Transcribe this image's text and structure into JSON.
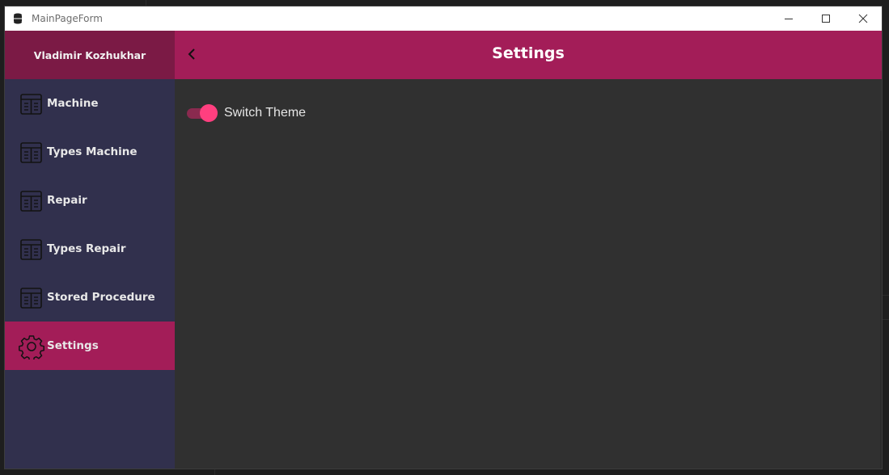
{
  "window": {
    "title": "MainPageForm"
  },
  "sidebar": {
    "user_name": "Vladimir Kozhukhar",
    "items": [
      {
        "label": "Machine",
        "icon": "table-icon",
        "active": false
      },
      {
        "label": "Types Machine",
        "icon": "table-icon",
        "active": false
      },
      {
        "label": "Repair",
        "icon": "table-icon",
        "active": false
      },
      {
        "label": "Types Repair",
        "icon": "table-icon",
        "active": false
      },
      {
        "label": "Stored Procedure",
        "icon": "table-icon",
        "active": false
      },
      {
        "label": "Settings",
        "icon": "gear-icon",
        "active": true
      }
    ]
  },
  "header": {
    "title": "Settings",
    "back_icon": "chevron-left-icon"
  },
  "settings": {
    "theme_toggle_label": "Switch Theme",
    "theme_toggle_on": true
  },
  "colors": {
    "accent": "#a31d58",
    "user_panel": "#7b1a45",
    "sidebar_bg": "#31304d",
    "content_bg": "#303030",
    "toggle_thumb": "#ff3f7f"
  }
}
